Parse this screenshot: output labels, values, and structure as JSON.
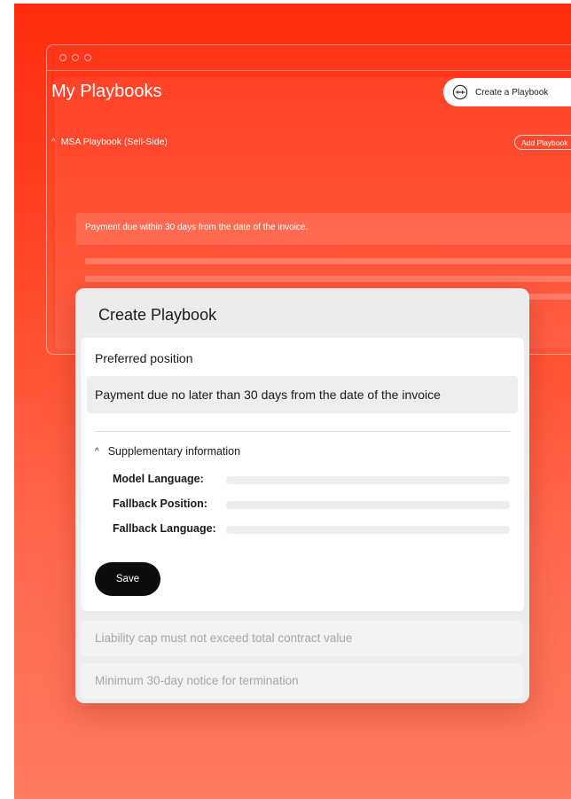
{
  "background_window": {
    "title": "My Playbooks",
    "create_button_label": "Create a Playbook",
    "playbook_name": "MSA Playbook (Sell-Side)",
    "add_button_label": "Add Playbook",
    "clause_text": "Payment due within 30 days from the date of the invoice."
  },
  "modal": {
    "title": "Create Playbook",
    "preferred_position_label": "Preferred position",
    "preferred_position_value": "Payment due no later than 30 days from the date of the invoice",
    "supplementary_label": "Supplementary information",
    "fields": [
      {
        "label": "Model Language:"
      },
      {
        "label": "Fallback Position:"
      },
      {
        "label": "Fallback Language:"
      }
    ],
    "save_label": "Save",
    "other_items": [
      "Liability cap must not exceed total contract value",
      "Minimum 30-day notice for termination"
    ]
  },
  "colors": {
    "accent_gradient_top": "#ff2a0d",
    "accent_gradient_bottom": "#ff7a5e",
    "save_button": "#0d0d0d"
  },
  "icons": {
    "create_button_icon": "arrows-circle-icon",
    "chevron_up": "chevron-up-icon"
  }
}
